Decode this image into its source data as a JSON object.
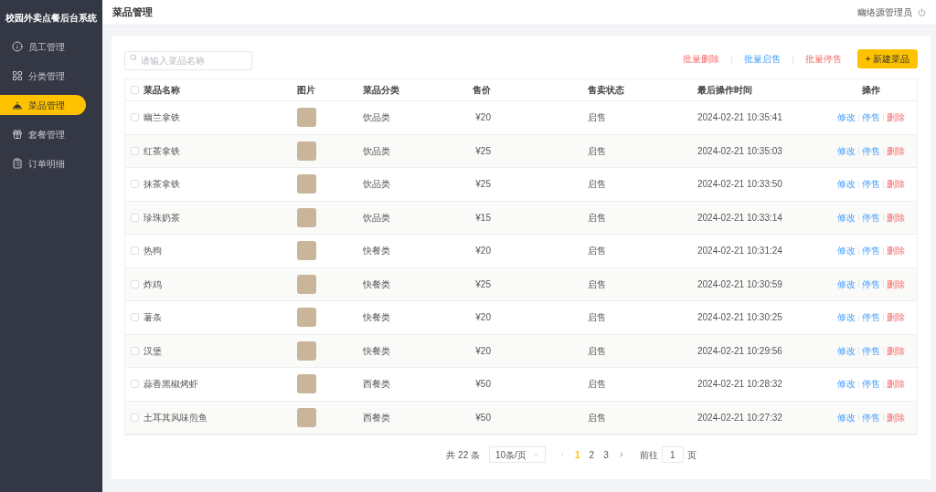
{
  "sidebar": {
    "title": "校园外卖点餐后台系统",
    "items": [
      {
        "label": "员工管理",
        "selected": false
      },
      {
        "label": "分类管理",
        "selected": false
      },
      {
        "label": "菜品管理",
        "selected": true
      },
      {
        "label": "套餐管理",
        "selected": false
      },
      {
        "label": "订单明细",
        "selected": false
      }
    ]
  },
  "header": {
    "title": "菜品管理",
    "user": "幽络源管理员"
  },
  "search": {
    "placeholder": "请输入菜品名称"
  },
  "toolbar": {
    "batch_actions": [
      {
        "label": "批量删除",
        "kind": "danger"
      },
      {
        "label": "批量启售",
        "kind": "link"
      },
      {
        "label": "批量停售",
        "kind": "danger"
      }
    ],
    "add_button": "+ 新建菜品"
  },
  "table": {
    "all_checked": false,
    "columns": [
      "菜品名称",
      "图片",
      "菜品分类",
      "售价",
      "售卖状态",
      "最后操作时间",
      "操作"
    ],
    "rows": [
      {
        "checked": false,
        "name": "幽兰拿铁",
        "category": "饮品类",
        "price": "¥20",
        "status": "启售",
        "time": "2024-02-21 10:35:41",
        "actions": [
          {
            "label": "修改",
            "kind": "link"
          },
          {
            "label": "停售",
            "kind": "link"
          },
          {
            "label": "删除",
            "kind": "danger"
          }
        ]
      },
      {
        "checked": false,
        "name": "红茶拿铁",
        "category": "饮品类",
        "price": "¥25",
        "status": "启售",
        "time": "2024-02-21 10:35:03",
        "actions": [
          {
            "label": "修改",
            "kind": "link"
          },
          {
            "label": "停售",
            "kind": "link"
          },
          {
            "label": "删除",
            "kind": "danger"
          }
        ]
      },
      {
        "checked": false,
        "name": "抹茶拿铁",
        "category": "饮品类",
        "price": "¥25",
        "status": "启售",
        "time": "2024-02-21 10:33:50",
        "actions": [
          {
            "label": "修改",
            "kind": "link"
          },
          {
            "label": "停售",
            "kind": "link"
          },
          {
            "label": "删除",
            "kind": "danger"
          }
        ]
      },
      {
        "checked": false,
        "name": "珍珠奶茶",
        "category": "饮品类",
        "price": "¥15",
        "status": "启售",
        "time": "2024-02-21 10:33:14",
        "actions": [
          {
            "label": "修改",
            "kind": "link"
          },
          {
            "label": "停售",
            "kind": "link"
          },
          {
            "label": "删除",
            "kind": "danger"
          }
        ]
      },
      {
        "checked": false,
        "name": "热狗",
        "category": "快餐类",
        "price": "¥20",
        "status": "启售",
        "time": "2024-02-21 10:31:24",
        "actions": [
          {
            "label": "修改",
            "kind": "link"
          },
          {
            "label": "停售",
            "kind": "link"
          },
          {
            "label": "删除",
            "kind": "danger"
          }
        ]
      },
      {
        "checked": false,
        "name": "炸鸡",
        "category": "快餐类",
        "price": "¥25",
        "status": "启售",
        "time": "2024-02-21 10:30:59",
        "actions": [
          {
            "label": "修改",
            "kind": "link"
          },
          {
            "label": "停售",
            "kind": "link"
          },
          {
            "label": "删除",
            "kind": "danger"
          }
        ]
      },
      {
        "checked": false,
        "name": "薯条",
        "category": "快餐类",
        "price": "¥20",
        "status": "启售",
        "time": "2024-02-21 10:30:25",
        "actions": [
          {
            "label": "修改",
            "kind": "link"
          },
          {
            "label": "停售",
            "kind": "link"
          },
          {
            "label": "删除",
            "kind": "danger"
          }
        ]
      },
      {
        "checked": false,
        "name": "汉堡",
        "category": "快餐类",
        "price": "¥20",
        "status": "启售",
        "time": "2024-02-21 10:29:56",
        "actions": [
          {
            "label": "修改",
            "kind": "link"
          },
          {
            "label": "停售",
            "kind": "link"
          },
          {
            "label": "删除",
            "kind": "danger"
          }
        ]
      },
      {
        "checked": false,
        "name": "蒜香黑椒烤虾",
        "category": "西餐类",
        "price": "¥50",
        "status": "启售",
        "time": "2024-02-21 10:28:32",
        "actions": [
          {
            "label": "修改",
            "kind": "link"
          },
          {
            "label": "停售",
            "kind": "link"
          },
          {
            "label": "删除",
            "kind": "danger"
          }
        ]
      },
      {
        "checked": false,
        "name": "土耳其风味煎鱼",
        "category": "西餐类",
        "price": "¥50",
        "status": "启售",
        "time": "2024-02-21 10:27:32",
        "actions": [
          {
            "label": "修改",
            "kind": "link"
          },
          {
            "label": "停售",
            "kind": "link"
          },
          {
            "label": "删除",
            "kind": "danger"
          }
        ]
      }
    ]
  },
  "pagination": {
    "total": "共 22 条",
    "page_size": "10条/页",
    "pages": [
      {
        "label": "1",
        "selected": true
      },
      {
        "label": "2",
        "selected": false
      },
      {
        "label": "3",
        "selected": false
      }
    ],
    "goto_label": "前往",
    "goto_value": "1",
    "goto_suffix": "页"
  }
}
